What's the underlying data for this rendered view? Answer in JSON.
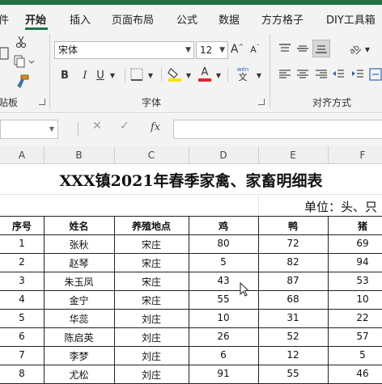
{
  "ribbon_tabs": [
    "件",
    "开始",
    "插入",
    "页面布局",
    "公式",
    "数据",
    "方方格子",
    "DIY工具箱"
  ],
  "ribbon": {
    "clipboard_label": "贴板",
    "font_label": "字体",
    "align_label": "对齐方式",
    "font_name": "宋体",
    "font_size": "12",
    "bold": "B",
    "italic": "I",
    "underline": "U",
    "phonetic_top": "wén",
    "phonetic_bottom": "文",
    "grow_font": "A",
    "shrink_font": "A",
    "font_color_letter": "A",
    "highlight_color": "#f5e400",
    "font_color": "#e0282e"
  },
  "formula_bar": {
    "cancel": "✕",
    "enter": "✓",
    "fx": "fx",
    "value": ""
  },
  "columns": [
    "A",
    "B",
    "C",
    "D",
    "E",
    "F"
  ],
  "sheet": {
    "title": "XXX镇2021年春季家禽、家畜明细表",
    "unit": "单位：头、只",
    "headers": [
      "序号",
      "姓名",
      "养殖地点",
      "鸡",
      "鸭",
      "猪"
    ],
    "rows": [
      [
        "1",
        "张秋",
        "宋庄",
        "80",
        "72",
        "69"
      ],
      [
        "2",
        "赵琴",
        "宋庄",
        "5",
        "82",
        "94"
      ],
      [
        "3",
        "朱玉凤",
        "宋庄",
        "43",
        "87",
        "53"
      ],
      [
        "4",
        "金宁",
        "宋庄",
        "55",
        "68",
        "10"
      ],
      [
        "5",
        "华蕊",
        "刘庄",
        "10",
        "31",
        "22"
      ],
      [
        "6",
        "陈启英",
        "刘庄",
        "26",
        "52",
        "57"
      ],
      [
        "7",
        "李梦",
        "刘庄",
        "6",
        "12",
        "5"
      ],
      [
        "8",
        "尤松",
        "刘庄",
        "91",
        "55",
        "46"
      ]
    ]
  },
  "colors": {
    "accent": "#217346"
  }
}
